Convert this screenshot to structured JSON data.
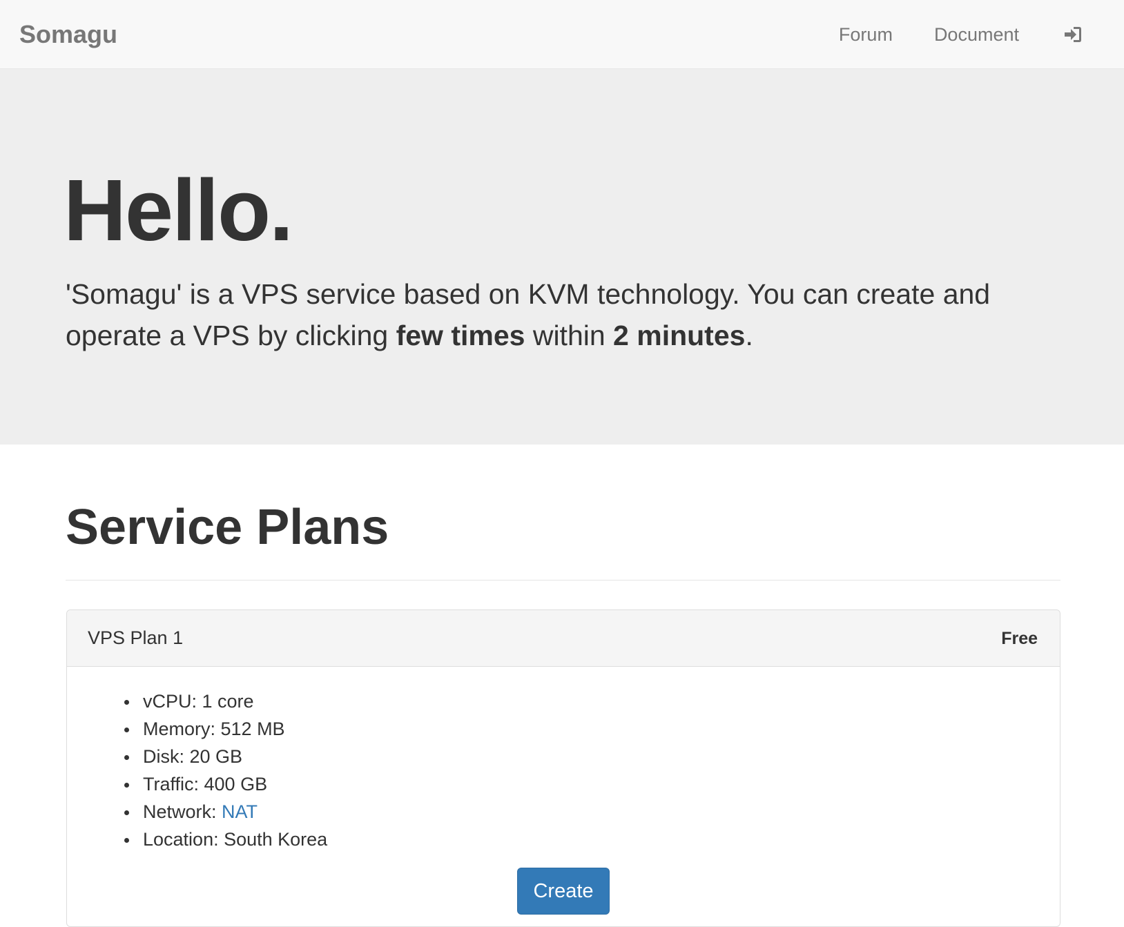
{
  "navbar": {
    "brand": "Somagu",
    "links": [
      {
        "label": "Forum"
      },
      {
        "label": "Document"
      }
    ],
    "signin_icon": "sign-in-icon"
  },
  "hero": {
    "title": "Hello.",
    "lead_part1": "'Somagu' is a VPS service based on KVM technology. You can create and operate a VPS by clicking ",
    "lead_bold1": "few times",
    "lead_part2": " within ",
    "lead_bold2": "2 minutes",
    "lead_part3": "."
  },
  "plans_section": {
    "title": "Service Plans"
  },
  "plan": {
    "name": "VPS Plan 1",
    "price": "Free",
    "specs": [
      {
        "label": "vCPU: ",
        "value": "1 core"
      },
      {
        "label": "Memory: ",
        "value": "512 MB"
      },
      {
        "label": "Disk: ",
        "value": "20 GB"
      },
      {
        "label": "Traffic: ",
        "value": "400 GB"
      },
      {
        "label": "Network: ",
        "value": "NAT",
        "link": true
      },
      {
        "label": "Location: ",
        "value": "South Korea"
      }
    ],
    "create_label": "Create"
  },
  "colors": {
    "primary": "#337ab7",
    "navbar_bg": "#f8f8f8",
    "jumbotron_bg": "#eeeeee",
    "text": "#333333",
    "muted": "#777777"
  }
}
